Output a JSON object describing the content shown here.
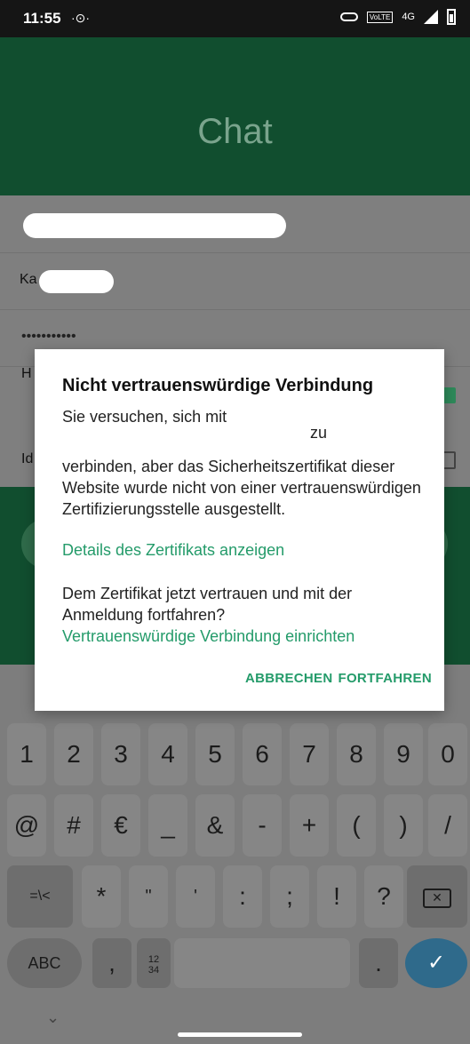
{
  "status_bar": {
    "time": "11:55",
    "time_symbol": "·⊙·",
    "network": "4G",
    "volte": "VoLTE",
    "icons": [
      "vpn-key-icon",
      "volte-icon",
      "signal-icon",
      "battery-icon"
    ]
  },
  "header": {
    "title": "Chat"
  },
  "form": {
    "row2_partial": "Ka",
    "password_masked": "•••••••••••",
    "row4_partial": "H",
    "row5_partial": "Id"
  },
  "dialog": {
    "title": "Nicht vertrauenswürdige Verbindung",
    "message_line1": "Sie versuchen, sich mit",
    "message_zu": "zu",
    "message_rest": "verbinden, aber das Sicherheitszertifikat dieser Website wurde nicht von einer vertrauenswürdigen Zertifizierungsstelle ausgestellt.",
    "link_details": "Details des Zertifikats anzeigen",
    "question": "Dem Zertifikat jetzt vertrauen und mit der Anmeldung fortfahren?",
    "link_setup": "Vertrauenswürdige Verbindung einrichten",
    "cancel_label": "ABBRECHEN",
    "continue_label": "FORTFAHREN"
  },
  "keyboard": {
    "row1": [
      "1",
      "2",
      "3",
      "4",
      "5",
      "6",
      "7",
      "8",
      "9",
      "0"
    ],
    "row2": [
      "@",
      "#",
      "€",
      "_",
      "&",
      "-",
      "+",
      "(",
      ")",
      "/"
    ],
    "row3": [
      "=\\<",
      "*",
      "\"",
      "'",
      ":",
      ";",
      "!",
      "?"
    ],
    "abc": "ABC",
    "comma": ",",
    "numpad": "12\n34",
    "period": ".",
    "enter": "✓",
    "chevron": "⌄"
  },
  "colors": {
    "accent": "#249b6a",
    "header_bg": "#114e2f",
    "dim": "#7f7f7f"
  }
}
